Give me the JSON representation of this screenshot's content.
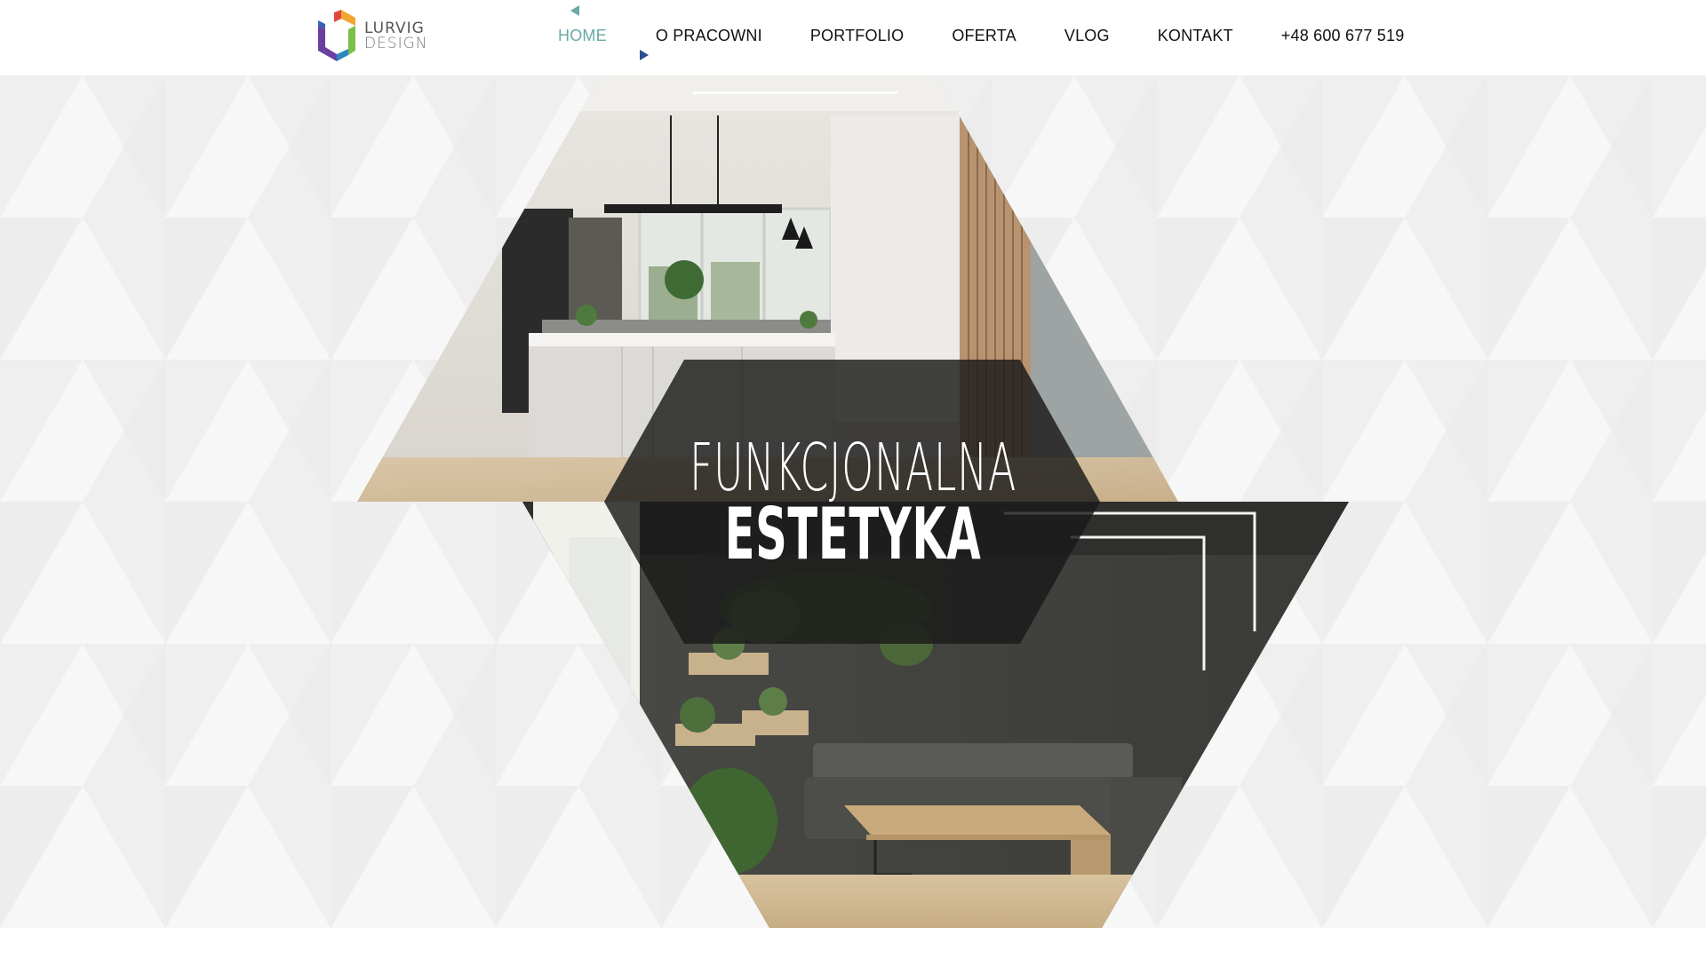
{
  "brand": {
    "line1": "LURVIG",
    "line2": "DESIGN",
    "colors": [
      "#e2473a",
      "#f2a531",
      "#7bbf4a",
      "#2e86c1",
      "#6b3fa0"
    ]
  },
  "nav": {
    "items": [
      {
        "label": "HOME",
        "active": true
      },
      {
        "label": "O PRACOWNI"
      },
      {
        "label": "PORTFOLIO"
      },
      {
        "label": "OFERTA"
      },
      {
        "label": "VLOG"
      },
      {
        "label": "KONTAKT"
      },
      {
        "label": "+48 600 677 519"
      }
    ],
    "active_color": "#6aa9a5",
    "accent_color": "#2e4d8f"
  },
  "hero": {
    "headline_light": "FUNKCJONALNA",
    "headline_bold": "ESTETYKA",
    "image_top": "kitchen-interior",
    "image_bottom": "living-room-interior"
  }
}
